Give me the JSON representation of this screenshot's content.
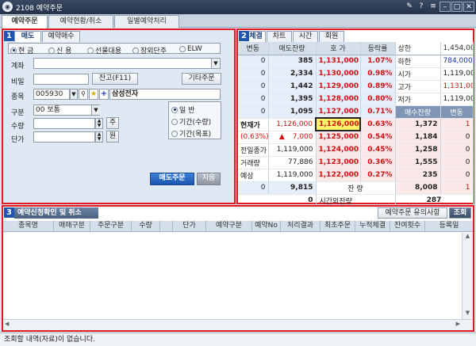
{
  "window": {
    "title": "2108 예약주문",
    "icon": "app-icon"
  },
  "main_tabs": [
    "예약주문",
    "예약현황/취소",
    "일별예약처리"
  ],
  "order": {
    "tabs": [
      "매도",
      "예약매수"
    ],
    "type_radios": [
      {
        "label": "현  금",
        "checked": true
      },
      {
        "label": "신  용",
        "checked": false
      },
      {
        "label": "선물대용",
        "checked": false
      },
      {
        "label": "장외단주",
        "checked": false
      },
      {
        "label": "ELW",
        "checked": false
      }
    ],
    "account_label": "계좌",
    "password_label": "비밀",
    "balance_btn": "잔고(F11)",
    "other_order_btn": "기타주문",
    "stock_label": "종목",
    "stock_code": "005930",
    "stock_name": "삼성전자",
    "class_label": "구분",
    "class_value": "00 보통",
    "qty_label": "수량",
    "qty_unit": "주",
    "price_label": "단가",
    "price_unit": "원",
    "period_radios": [
      {
        "label": "일      반",
        "checked": true
      },
      {
        "label": "기간(수량)",
        "checked": false
      },
      {
        "label": "기간(목표)",
        "checked": false
      }
    ],
    "sell_btn": "매도주문",
    "clear_btn": "지움"
  },
  "orderbook": {
    "tabs": [
      "체결",
      "차트",
      "시간",
      "회원"
    ],
    "headers": [
      "변동",
      "매도잔량",
      "호 가",
      "등락률"
    ],
    "asks": [
      {
        "change": "0",
        "qty": "385",
        "price": "1,131,000",
        "rate": "1.07%"
      },
      {
        "change": "0",
        "qty": "2,334",
        "price": "1,130,000",
        "rate": "0.98%"
      },
      {
        "change": "0",
        "qty": "1,442",
        "price": "1,129,000",
        "rate": "0.89%"
      },
      {
        "change": "0",
        "qty": "1,395",
        "price": "1,128,000",
        "rate": "0.80%"
      },
      {
        "change": "0",
        "qty": "1,095",
        "price": "1,127,000",
        "rate": "0.71%"
      }
    ],
    "stats_top": [
      {
        "label": "상한",
        "value": "1,454,000"
      },
      {
        "label": "하한",
        "value": "784,000"
      },
      {
        "label": "시가",
        "value": "1,119,000"
      },
      {
        "label": "고가",
        "value": "1,131,000"
      },
      {
        "label": "저가",
        "value": "1,119,000"
      }
    ],
    "bid_headers": [
      "매수잔량",
      "변동"
    ],
    "info": [
      {
        "label": "현재가",
        "value": "1,126,000"
      },
      {
        "label": "(0.63%)",
        "value": "7,000",
        "arrow": "▲"
      },
      {
        "label": "전일종가",
        "value": "1,119,000"
      },
      {
        "label": "거래량",
        "value": "77,886"
      },
      {
        "label": "예상",
        "value": "1,119,000"
      }
    ],
    "bids": [
      {
        "price": "1,126,000",
        "rate": "0.63%",
        "qty": "1,372",
        "change": "1"
      },
      {
        "price": "1,125,000",
        "rate": "0.54%",
        "qty": "1,184",
        "change": "0"
      },
      {
        "price": "1,124,000",
        "rate": "0.45%",
        "qty": "1,258",
        "change": "0"
      },
      {
        "price": "1,123,000",
        "rate": "0.36%",
        "qty": "1,555",
        "change": "0"
      },
      {
        "price": "1,122,000",
        "rate": "0.27%",
        "qty": "235",
        "change": "0"
      }
    ],
    "total_row": {
      "change": "0",
      "ask_total": "9,815",
      "label": "잔 량",
      "bid_total": "8,008",
      "bid_change": "1"
    },
    "after_row": {
      "ask": "0",
      "label": "시간외잔량",
      "bid": "287"
    }
  },
  "confirm": {
    "title": "예약신청확인 및 취소",
    "notice_btn": "예약주문 유의사항",
    "query_btn": "조회",
    "columns": [
      "종목명",
      "매매구분",
      "주문구분",
      "수량",
      "단가",
      "예약구분",
      "예약No",
      "처리결과",
      "최초주문",
      "누적체결",
      "잔여횟수",
      "등록일"
    ]
  },
  "status": {
    "message": "조회할 내역(자료)이 없습니다."
  }
}
